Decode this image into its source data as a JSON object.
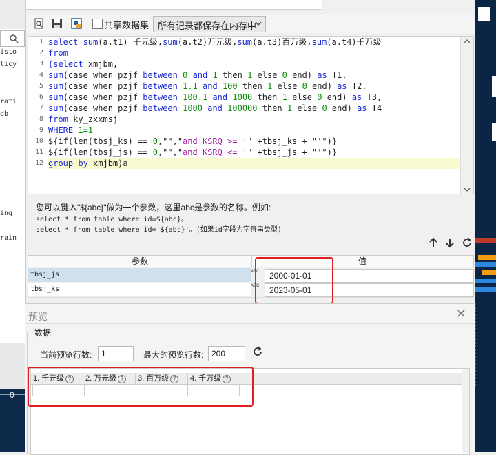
{
  "toolbar": {
    "share_label": "共享数据集",
    "memory_select": "所有记录都保存在内存中"
  },
  "left_panel": {
    "items": [
      "isto",
      "licy",
      "rati",
      "db",
      "ing",
      "rain"
    ],
    "bottom_value": "0"
  },
  "editor": {
    "line_numbers": [
      "1",
      "2",
      "3",
      "4",
      "5",
      "6",
      "7",
      "8",
      "9",
      "10",
      "11",
      "12"
    ],
    "lines": [
      [
        {
          "t": "select ",
          "c": "k"
        },
        {
          "t": "sum",
          "c": "k"
        },
        {
          "t": "(a.t1) 千元级,"
        },
        {
          "t": "sum",
          "c": "k"
        },
        {
          "t": "(a.t2)万元级,"
        },
        {
          "t": "sum",
          "c": "k"
        },
        {
          "t": "(a.t3)百万级,"
        },
        {
          "t": "sum",
          "c": "k"
        },
        {
          "t": "(a.t4)千万级"
        }
      ],
      [
        {
          "t": "from",
          "c": "k"
        }
      ],
      [
        {
          "t": "(",
          "c": "k"
        },
        {
          "t": "select",
          "c": "k"
        },
        {
          "t": " xmjbm,"
        }
      ],
      [
        {
          "t": "sum",
          "c": "k"
        },
        {
          "t": "(case when pzjf "
        },
        {
          "t": "between",
          "c": "k"
        },
        {
          "t": " "
        },
        {
          "t": "0",
          "c": "n"
        },
        {
          "t": " "
        },
        {
          "t": "and",
          "c": "k"
        },
        {
          "t": " "
        },
        {
          "t": "1",
          "c": "n"
        },
        {
          "t": " then "
        },
        {
          "t": "1",
          "c": "n"
        },
        {
          "t": " else "
        },
        {
          "t": "0",
          "c": "n"
        },
        {
          "t": " end) "
        },
        {
          "t": "as",
          "c": "k"
        },
        {
          "t": " T1,"
        }
      ],
      [
        {
          "t": "sum",
          "c": "k"
        },
        {
          "t": "(case when pzjf "
        },
        {
          "t": "between",
          "c": "k"
        },
        {
          "t": " "
        },
        {
          "t": "1.1",
          "c": "n"
        },
        {
          "t": " "
        },
        {
          "t": "and",
          "c": "k"
        },
        {
          "t": " "
        },
        {
          "t": "100",
          "c": "n"
        },
        {
          "t": " then "
        },
        {
          "t": "1",
          "c": "n"
        },
        {
          "t": " else "
        },
        {
          "t": "0",
          "c": "n"
        },
        {
          "t": " end) "
        },
        {
          "t": "as",
          "c": "k"
        },
        {
          "t": " T2,"
        }
      ],
      [
        {
          "t": "sum",
          "c": "k"
        },
        {
          "t": "(case when pzjf "
        },
        {
          "t": "between",
          "c": "k"
        },
        {
          "t": " "
        },
        {
          "t": "100.1",
          "c": "n"
        },
        {
          "t": " "
        },
        {
          "t": "and",
          "c": "k"
        },
        {
          "t": " "
        },
        {
          "t": "1000",
          "c": "n"
        },
        {
          "t": " then "
        },
        {
          "t": "1",
          "c": "n"
        },
        {
          "t": " else "
        },
        {
          "t": "0",
          "c": "n"
        },
        {
          "t": " end) "
        },
        {
          "t": "as",
          "c": "k"
        },
        {
          "t": " T3,"
        }
      ],
      [
        {
          "t": "sum",
          "c": "k"
        },
        {
          "t": "(case when pzjf "
        },
        {
          "t": "between",
          "c": "k"
        },
        {
          "t": " "
        },
        {
          "t": "1000",
          "c": "n"
        },
        {
          "t": " "
        },
        {
          "t": "and",
          "c": "k"
        },
        {
          "t": " "
        },
        {
          "t": "100000",
          "c": "n"
        },
        {
          "t": " then "
        },
        {
          "t": "1",
          "c": "n"
        },
        {
          "t": " else "
        },
        {
          "t": "0",
          "c": "n"
        },
        {
          "t": " end) "
        },
        {
          "t": "as",
          "c": "k"
        },
        {
          "t": " T4"
        }
      ],
      [
        {
          "t": "from",
          "c": "k"
        },
        {
          "t": " ky_zxxmsj"
        }
      ],
      [
        {
          "t": "WHERE",
          "c": "k"
        },
        {
          "t": " "
        },
        {
          "t": "1=1",
          "c": "n"
        }
      ],
      [
        {
          "t": "${if(len(tbsj_ks) == "
        },
        {
          "t": "0",
          "c": "n"
        },
        {
          "t": ",\"\",\""
        },
        {
          "t": "and KSRQ >= '",
          "c": "s"
        },
        {
          "t": "\" +tbsj_ks + \""
        },
        {
          "t": "'",
          "c": "s"
        },
        {
          "t": "\")}"
        }
      ],
      [
        {
          "t": "${if(len(tbsj_js) == "
        },
        {
          "t": "0",
          "c": "n"
        },
        {
          "t": ",\"\",\""
        },
        {
          "t": "and KSRQ <= '",
          "c": "s"
        },
        {
          "t": "\" +tbsj_js + \""
        },
        {
          "t": "'",
          "c": "s"
        },
        {
          "t": "\")}"
        }
      ],
      [
        {
          "t": "group by",
          "c": "k"
        },
        {
          "t": " xmjbm)a"
        }
      ]
    ]
  },
  "help": {
    "line1": "您可以键入\"${abc}\"做为一个参数，这里abc是参数的名称。例如:",
    "line2": "select * from table where id=${abc}。",
    "line3": "select * from table where id='${abc}'。(如果id字段为字符串类型)"
  },
  "params": {
    "header_name": "参数",
    "header_value": "值",
    "type_label": "ABC",
    "rows": [
      {
        "name": "tbsj_js",
        "value": "2000-01-01"
      },
      {
        "name": "tbsj_ks",
        "value": "2023-05-01"
      }
    ]
  },
  "preview": {
    "title": "预览",
    "close": "✕",
    "group_label": "数据",
    "rows_label": "当前预览行数:",
    "rows_value": "1",
    "max_label": "最大的预览行数:",
    "max_value": "200",
    "columns": [
      "1. 千元级",
      "2. 万元级",
      "3. 百万级",
      "4. 千万级"
    ],
    "help_mark": "?"
  },
  "colors": {
    "keyword": "#1a2bd6",
    "string": "#a020a0",
    "number": "#0a8a0a",
    "annotation": "#e02020",
    "highlight_line": "#fafad0"
  }
}
